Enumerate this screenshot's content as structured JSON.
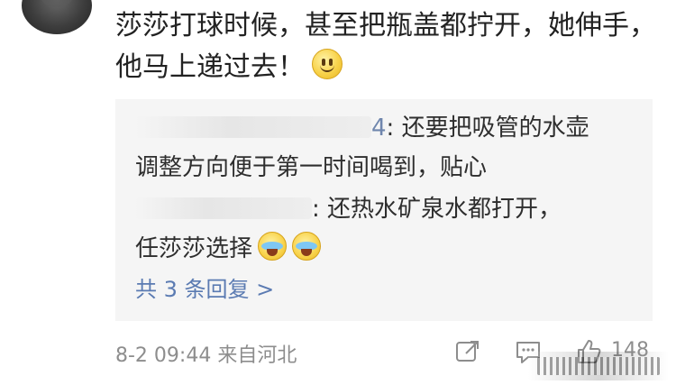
{
  "comment": {
    "text": "莎莎打球时候，甚至把瓶盖都拧开，她伸手，他马上递过去！",
    "emoji": "smile-icon"
  },
  "replies": [
    {
      "username_visible": "4",
      "text_1": ": 还要把吸管的水壶",
      "text_2": "调整方向便于第一时间喝到，贴心"
    },
    {
      "username_visible": "",
      "text_1": ": 还热水矿泉水都打开，",
      "text_2": "任莎莎选择",
      "emojis": [
        "cry-laugh-icon",
        "cry-laugh-icon"
      ]
    }
  ],
  "reply_summary": {
    "text": "共 3 条回复 >"
  },
  "footer": {
    "date": "8-2 09:44",
    "location": "来自河北",
    "like_count": "148"
  },
  "colors": {
    "link": "#5b7bb2",
    "secondary": "#8d8d8d",
    "reply_bg": "#f5f5f5"
  }
}
